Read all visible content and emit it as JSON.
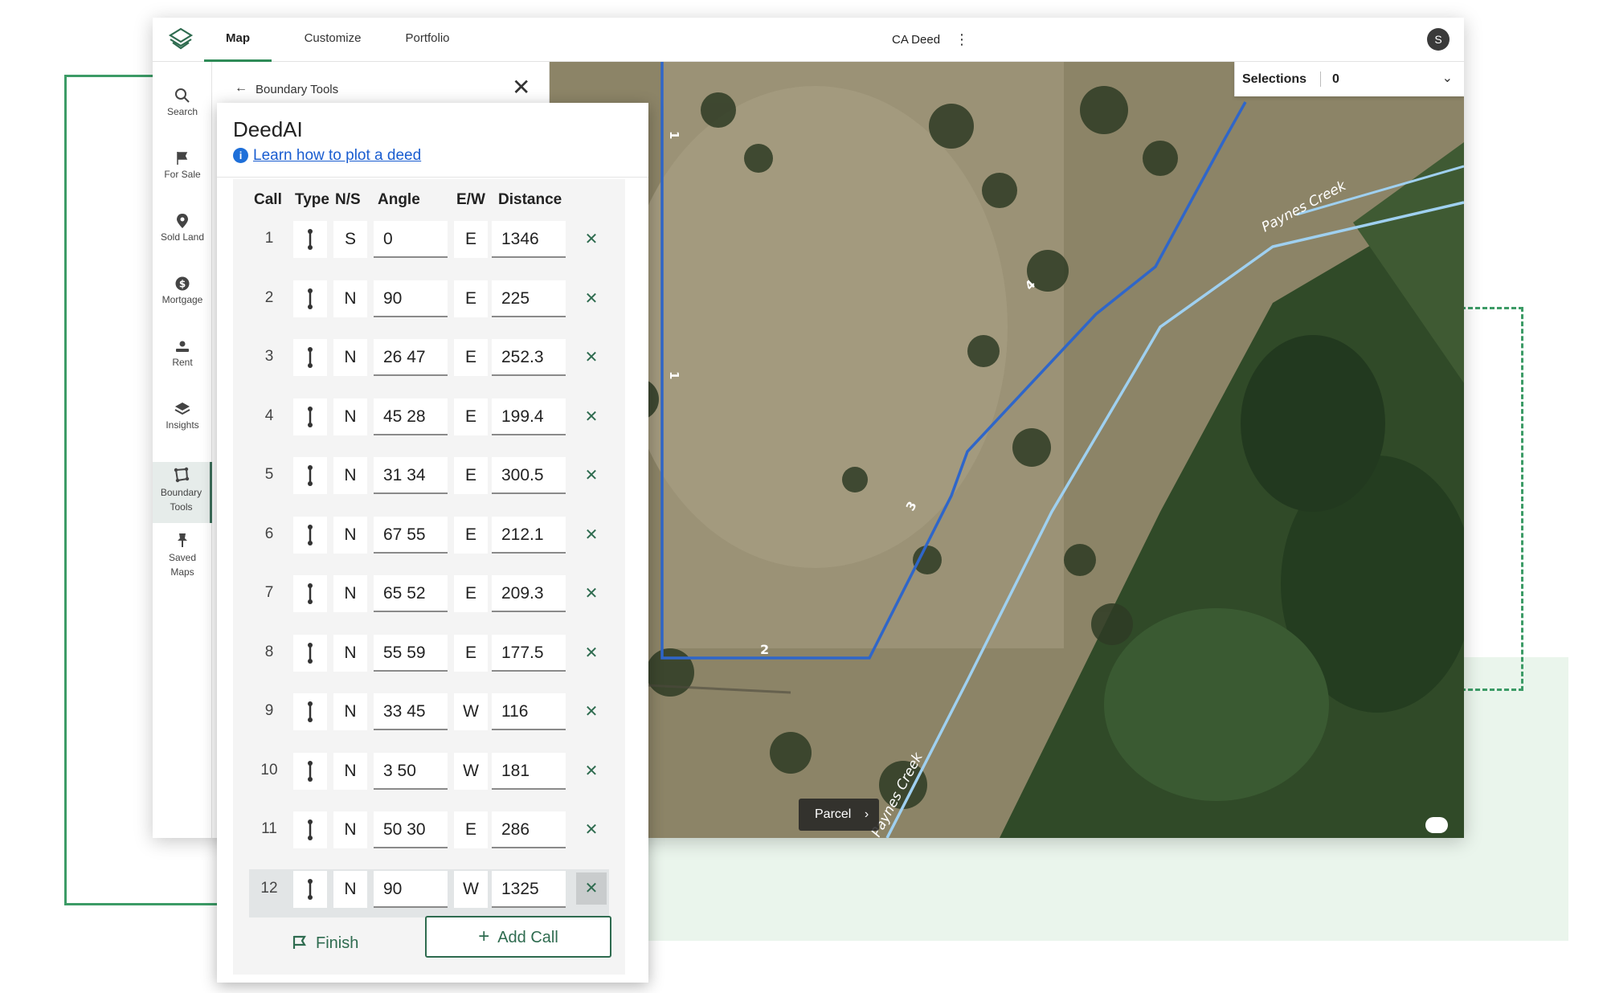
{
  "nav": {
    "tabs": [
      {
        "label": "Map",
        "active": true
      },
      {
        "label": "Customize",
        "active": false
      },
      {
        "label": "Portfolio",
        "active": false
      }
    ],
    "document_title": "CA Deed",
    "user_initial": "S"
  },
  "sidebar": {
    "items": [
      {
        "label": "Search",
        "icon": "search-icon"
      },
      {
        "label": "For Sale",
        "icon": "flag-icon"
      },
      {
        "label": "Sold Land",
        "icon": "map-pin-icon"
      },
      {
        "label": "Mortgage",
        "icon": "dollar-icon"
      },
      {
        "label": "Rent",
        "icon": "hand-money-icon"
      },
      {
        "label": "Insights",
        "icon": "layers-icon"
      },
      {
        "label": "Boundary Tools",
        "icon": "boundary-icon",
        "active": true
      },
      {
        "label": "Saved Maps",
        "icon": "pin-icon"
      }
    ]
  },
  "tools_panel": {
    "title": "Boundary Tools"
  },
  "map": {
    "selections_label": "Selections",
    "selections_count": "0",
    "parcel_button": "Parcel",
    "creek_label": "Paynes Creek",
    "boundary_color": "#2f66c9",
    "creek_color": "#9fd0f0",
    "segment_labels": [
      "1",
      "1",
      "2",
      "3",
      "4"
    ]
  },
  "deed": {
    "title": "DeedAI",
    "learn_link": "Learn how to plot a deed",
    "columns": [
      "Call",
      "Type",
      "N/S",
      "Angle",
      "E/W",
      "Distance"
    ],
    "calls": [
      {
        "call": "1",
        "ns": "S",
        "angle": "0",
        "ew": "E",
        "distance": "1346"
      },
      {
        "call": "2",
        "ns": "N",
        "angle": "90",
        "ew": "E",
        "distance": "225"
      },
      {
        "call": "3",
        "ns": "N",
        "angle": "26 47",
        "ew": "E",
        "distance": "252.3"
      },
      {
        "call": "4",
        "ns": "N",
        "angle": "45 28",
        "ew": "E",
        "distance": "199.4"
      },
      {
        "call": "5",
        "ns": "N",
        "angle": "31 34",
        "ew": "E",
        "distance": "300.5"
      },
      {
        "call": "6",
        "ns": "N",
        "angle": "67 55",
        "ew": "E",
        "distance": "212.1"
      },
      {
        "call": "7",
        "ns": "N",
        "angle": "65 52",
        "ew": "E",
        "distance": "209.3"
      },
      {
        "call": "8",
        "ns": "N",
        "angle": "55 59",
        "ew": "E",
        "distance": "177.5"
      },
      {
        "call": "9",
        "ns": "N",
        "angle": "33 45",
        "ew": "W",
        "distance": "116"
      },
      {
        "call": "10",
        "ns": "N",
        "angle": "3 50",
        "ew": "W",
        "distance": "181"
      },
      {
        "call": "11",
        "ns": "N",
        "angle": "50 30",
        "ew": "E",
        "distance": "286"
      },
      {
        "call": "12",
        "ns": "N",
        "angle": "90",
        "ew": "W",
        "distance": "1325"
      }
    ],
    "finish_label": "Finish",
    "add_call_label": "Add Call"
  },
  "colors": {
    "brand_green": "#2e6b4f",
    "accent_green": "#3c9b66"
  }
}
